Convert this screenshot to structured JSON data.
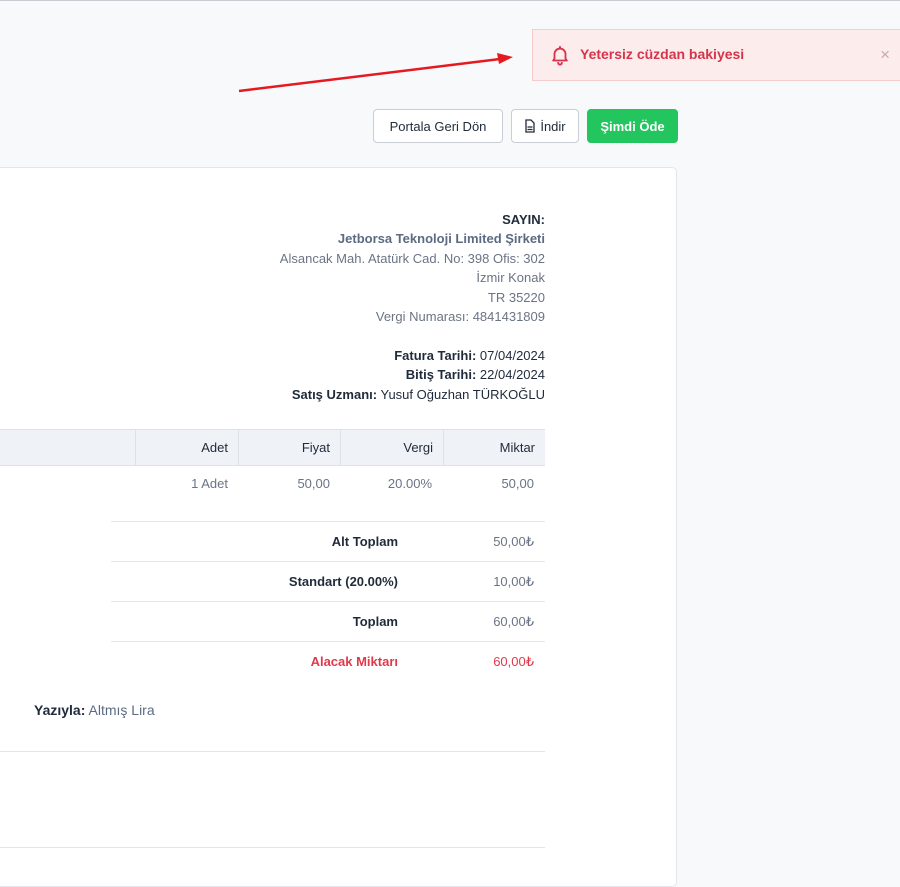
{
  "toast": {
    "message": "Yetersiz cüzdan bakiyesi",
    "icon": "bell-icon",
    "close_symbol": "×",
    "color": "#d6344a"
  },
  "actions": {
    "back_label": "Portala Geri Dön",
    "download_label": "İndir",
    "pay_label": "Şimdi Öde",
    "pay_color": "#23c55e"
  },
  "billing": {
    "to_label": "SAYIN:",
    "company": "Jetborsa Teknoloji Limited Şirketi",
    "address_line1": "Alsancak Mah. Atatürk Cad. No: 398 Ofis: 302",
    "address_line2": "İzmir Konak",
    "address_line3": "TR 35220",
    "tax_number": "Vergi Numarası: 4841431809"
  },
  "invoice_meta": {
    "invoice_date_label": "Fatura Tarihi:",
    "invoice_date": "07/04/2024",
    "due_date_label": "Bitiş Tarihi:",
    "due_date": "22/04/2024",
    "sales_rep_label": "Satış Uzmanı:",
    "sales_rep": "Yusuf Oğuzhan TÜRKOĞLU"
  },
  "items_table": {
    "headers": [
      "Adet",
      "Fiyat",
      "Vergi",
      "Miktar"
    ],
    "rows": [
      [
        "1 Adet",
        "50,00",
        "20.00%",
        "50,00"
      ]
    ]
  },
  "totals": [
    {
      "label": "Alt Toplam",
      "value": "50,00₺"
    },
    {
      "label": "Standart (20.00%)",
      "value": "10,00₺"
    },
    {
      "label": "Toplam",
      "value": "60,00₺"
    },
    {
      "label": "Alacak Miktarı",
      "value": "60,00₺"
    }
  ],
  "amount_in_words": {
    "label": "Yazıyla:",
    "value": "Altmış Lira"
  }
}
